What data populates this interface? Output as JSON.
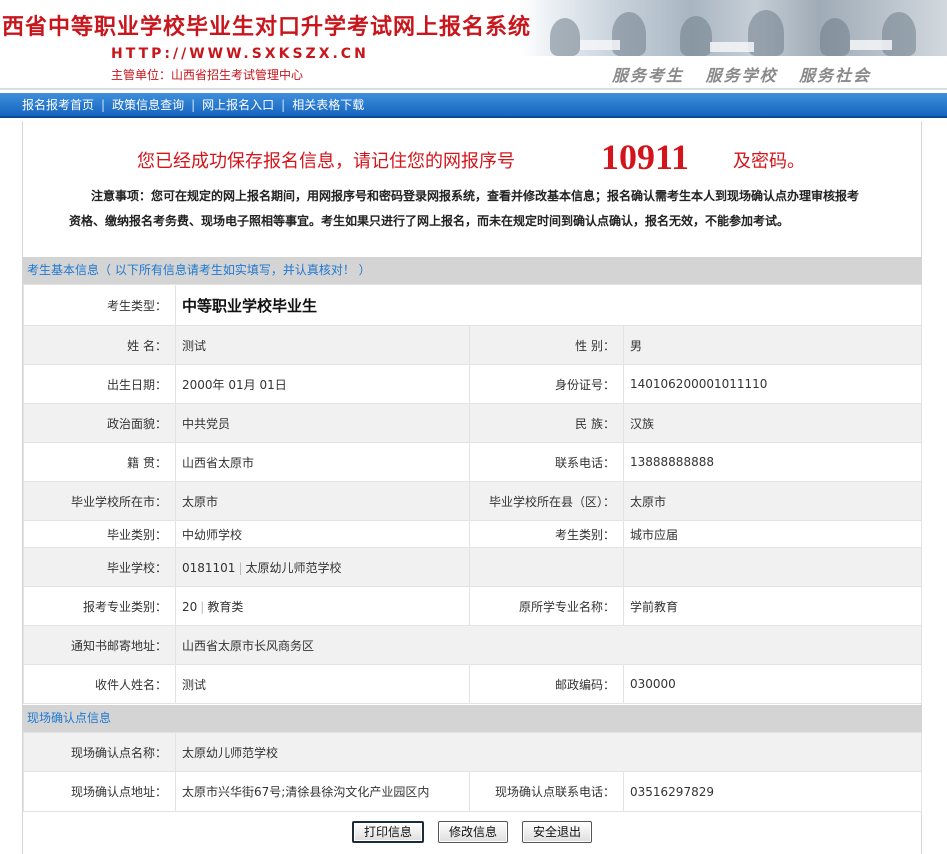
{
  "header": {
    "title": "西省中等职业学校毕业生对口升学考试网上报名系统",
    "url": "HTTP://WWW.SXKSZX.CN",
    "org": "主管单位：山西省招生考试管理中心",
    "slogan": "服务考生  服务学校  服务社会"
  },
  "nav": {
    "items": [
      {
        "label": "报名报考首页"
      },
      {
        "label": "政策信息查询"
      },
      {
        "label": "网上报名入口"
      },
      {
        "label": "相关表格下载"
      }
    ],
    "separator": "|"
  },
  "notice": {
    "saved_text": "您已经成功保存报名信息，请记住您的网报序号",
    "serial_number": "10911",
    "saved_suffix": "及密码。",
    "note_title": "注意事项：",
    "note_body": "您可在规定的网上报名期间，用网报序号和密码登录网报系统，查看并修改基本信息；报名确认需考生本人到现场确认点办理审核报考资格、缴纳报名考务费、现场电子照相等事宜。考生如果只进行了网上报名，而未在规定时间到确认点确认，报名无效，不能参加考试。"
  },
  "basic_section": {
    "title": "考生基本信息（ 以下所有信息请考生如实填写，并认真核对！ ）",
    "exam_type_label": "考生类型：",
    "exam_type_value": "中等职业学校毕业生",
    "name_label": "姓    名：",
    "name_value": "测试",
    "gender_label": "性    别：",
    "gender_value": "男",
    "birth_label": "出生日期：",
    "birth_value": "2000年 01月 01日",
    "id_label": "身份证号：",
    "id_value": "140106200001011110",
    "political_label": "政治面貌：",
    "political_value": "中共党员",
    "ethnic_label": "民    族：",
    "ethnic_value": "汉族",
    "native_label": "籍    贯：",
    "native_value": "山西省太原市",
    "phone_label": "联系电话：",
    "phone_value": "13888888888",
    "school_city_label": "毕业学校所在市：",
    "school_city_value": "太原市",
    "school_county_label": "毕业学校所在县（区）：",
    "school_county_value": "太原市",
    "grad_category_label": "毕业类别：",
    "grad_category_value": "中幼师学校",
    "candidate_category_label": "考生类别：",
    "candidate_category_value": "城市应届",
    "school_label": "毕业学校：",
    "school_code": "0181101",
    "school_name": "太原幼儿师范学校",
    "major_category_label": "报考专业类别：",
    "major_category_code": "20",
    "major_category_name": "教育类",
    "original_major_label": "原所学专业名称：",
    "original_major_value": "学前教育",
    "address_label": "通知书邮寄地址：",
    "address_value": "山西省太原市长风商务区",
    "receiver_label": "收件人姓名：",
    "receiver_value": "测试",
    "postcode_label": "邮政编码：",
    "postcode_value": "030000"
  },
  "confirm_section": {
    "title": "现场确认点信息",
    "point_name_label": "现场确认点名称：",
    "point_name_value": "太原幼儿师范学校",
    "point_address_label": "现场确认点地址：",
    "point_address_value": "太原市兴华街67号;清徐县徐沟文化产业园区内",
    "point_phone_label": "现场确认点联系电话：",
    "point_phone_value": "03516297829"
  },
  "buttons": {
    "print": "打印信息",
    "modify": "修改信息",
    "logout": "安全退出"
  }
}
